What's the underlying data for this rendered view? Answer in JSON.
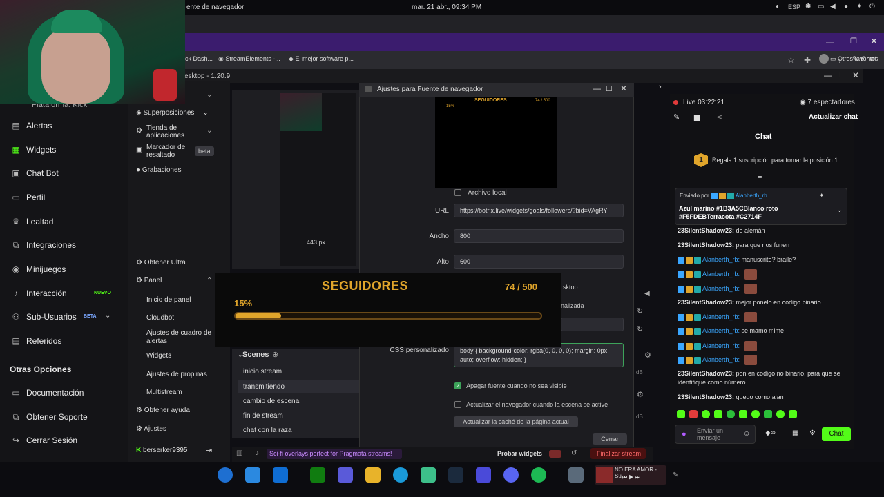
{
  "system": {
    "window_title": "ente de navegador",
    "clock": "mar. 21 abr., 09:34 PM",
    "lang": "ESP"
  },
  "browser": {
    "bookmarks": [
      "ck Dash...",
      "StreamElements -...",
      "El mejor software p..."
    ],
    "other_favorites": "Otros favoritos",
    "chat_tab": "Chat"
  },
  "kick_nav": {
    "platform_label": "Plataforma: Kick",
    "items": [
      {
        "label": "Alertas",
        "icon": "alert-icon"
      },
      {
        "label": "Widgets",
        "icon": "widgets-icon"
      },
      {
        "label": "Chat Bot",
        "icon": "chatbot-icon"
      },
      {
        "label": "Perfil",
        "icon": "profile-icon"
      },
      {
        "label": "Lealtad",
        "icon": "trophy-icon"
      },
      {
        "label": "Integraciones",
        "icon": "integrations-icon"
      },
      {
        "label": "Minijuegos",
        "icon": "gamepad-icon"
      },
      {
        "label": "Interacción",
        "icon": "music-icon",
        "badge": "NUEVO"
      },
      {
        "label": "Sub-Usuarios",
        "icon": "users-icon",
        "badge": "BETA"
      },
      {
        "label": "Referidos",
        "icon": "referral-icon"
      }
    ],
    "section": "Otras Opciones",
    "other_items": [
      "Documentación",
      "Obtener Soporte",
      "Cerrar Sesión"
    ]
  },
  "dashboard": {
    "items": [
      {
        "label": "Superposiciones"
      },
      {
        "label": "Tienda de aplicaciones"
      },
      {
        "label": "Marcador de resaltado",
        "pill": "beta"
      },
      {
        "label": "Grabaciones"
      }
    ],
    "obtener_ultra": "Obtener Ultra",
    "panel": "Panel",
    "panel_items": [
      "Inicio de panel",
      "Cloudbot",
      "Ajustes de cuadro de alertas",
      "Widgets",
      "Ajustes de propinas",
      "Multistream"
    ],
    "obtener_ayuda": "Obtener ayuda",
    "ajustes": "Ajustes",
    "username": "berserker9395"
  },
  "obs": {
    "title": "esktop - 1.20.9",
    "px_label": "443 px",
    "scenes_title": "Scenes",
    "scenes": [
      "inicio stream",
      "transmitiendo",
      "cambio de escena",
      "fin de stream",
      "chat con la raza"
    ],
    "status_text": "Sci-fi overlays perfect for Pragmata streams!",
    "probar": "Probar widgets",
    "finalizar": "Finalizar stream"
  },
  "dialog": {
    "title": "Ajustes para Fuente de navegador",
    "local_file": "Archivo local",
    "url_label": "URL",
    "url_value": "https://botrix.live/widgets/goals/followers/?bid=VAgRY",
    "width_label": "Ancho",
    "width_value": "800",
    "height_label": "Alto",
    "height_value": "600",
    "hidden_a": "sktop",
    "hidden_b": "nalizada",
    "css_label": "CSS personalizado",
    "css_value": "body { background-color: rgba(0, 0, 0, 0); margin: 0px auto; overflow: hidden; }",
    "opt1": "Apagar fuente cuando no sea visible",
    "opt2": "Actualizar el navegador cuando la escena se active",
    "refresh_btn": "Actualizar la caché de la página actual",
    "close_btn": "Cerrar",
    "preview_title": "SEGUIDORES",
    "preview_count": "74 / 500",
    "preview_pct": "15%"
  },
  "overlay": {
    "title": "SEGUIDORES",
    "count": "74 / 500",
    "percent": "15%",
    "progress": 0.15
  },
  "chat": {
    "live": "Live 03:22:21",
    "viewers": "7 espectadores",
    "refresh": "Actualizar chat",
    "title": "Chat",
    "gift_num": "1",
    "gift_text": "Regala 1 suscripción para tomar la posición 1",
    "pinned_by": "Enviado por",
    "pinned_user": "Alanberth_rb",
    "pinned_text": "Azul marino #1B3A5CBlanco roto #F5FDEBTerracota #C2714F",
    "messages": [
      {
        "user": "23SilentShadow23:",
        "text": "de alemán"
      },
      {
        "user": "23SilentShadow23:",
        "text": "para que nos funen"
      },
      {
        "user": "Alanberth_rb:",
        "text": "manuscrito? braile?",
        "blue": true
      },
      {
        "user": "Alanberth_rb:",
        "text": "",
        "blue": true,
        "emote": true
      },
      {
        "user": "Alanberth_rb:",
        "text": "",
        "blue": true,
        "emote": true
      },
      {
        "user": "23SilentShadow23:",
        "text": "mejor ponelo en codigo binario"
      },
      {
        "user": "Alanberth_rb:",
        "text": "",
        "blue": true,
        "emote": true
      },
      {
        "user": "Alanberth_rb:",
        "text": "se mamo mime",
        "blue": true
      },
      {
        "user": "Alanberth_rb:",
        "text": "",
        "blue": true,
        "emote": true
      },
      {
        "user": "Alanberth_rb:",
        "text": "",
        "blue": true,
        "emote": true
      },
      {
        "user": "23SilentShadow23:",
        "text": "pon en codigo no binario, para que se identifique como número"
      },
      {
        "user": "23SilentShadow23:",
        "text": "quedo como alan"
      }
    ],
    "input_placeholder": "Enviar un mensaje",
    "send": "Chat"
  },
  "taskbar": {
    "media_text": "NO ERA AMOR - Su..."
  },
  "colors": {
    "kick_green": "#53fc18",
    "overlay_gold": "#e0a52b",
    "accent_purple": "#3b1c6e"
  }
}
